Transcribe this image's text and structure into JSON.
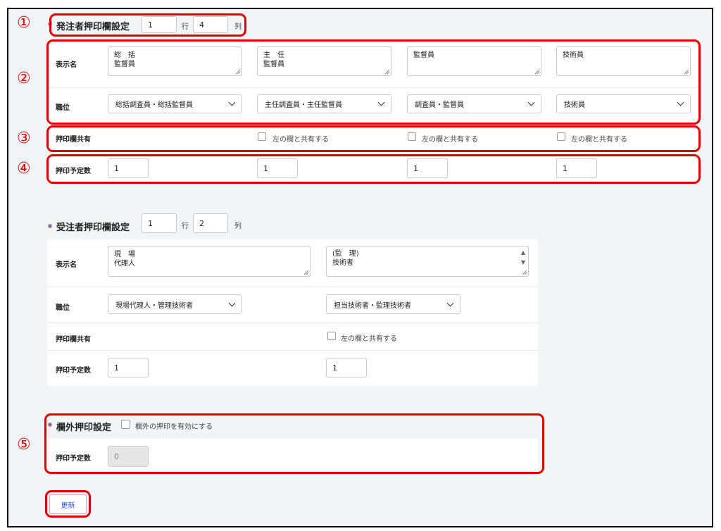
{
  "markers": [
    "①",
    "②",
    "③",
    "④",
    "⑤"
  ],
  "orderer": {
    "title": "発注者押印欄設定",
    "rows_value": "1",
    "rows_unit": "行",
    "cols_value": "4",
    "cols_unit": "列",
    "display_name_label": "表示名",
    "position_label": "職位",
    "share_label": "押印欄共有",
    "planned_label": "押印予定数",
    "columns": [
      {
        "display_name": "総　括\n監督員",
        "position": "総括調査員・総括監督員",
        "share": "",
        "planned": "1"
      },
      {
        "display_name": "主　任\n監督員",
        "position": "主任調査員・主任監督員",
        "share": "左の欄と共有する",
        "planned": "1"
      },
      {
        "display_name": "監督員",
        "position": "調査員・監督員",
        "share": "左の欄と共有する",
        "planned": "1"
      },
      {
        "display_name": "技術員",
        "position": "技術員",
        "share": "左の欄と共有する",
        "planned": "1"
      }
    ]
  },
  "contractor": {
    "title": "受注者押印欄設定",
    "rows_value": "1",
    "rows_unit": "行",
    "cols_value": "2",
    "cols_unit": "列",
    "display_name_label": "表示名",
    "position_label": "職位",
    "share_label": "押印欄共有",
    "planned_label": "押印予定数",
    "columns": [
      {
        "display_name": "現　場\n代理人",
        "position": "現場代理人・管理技術者",
        "share": "",
        "planned": "1"
      },
      {
        "display_name": "(監　理)\n技術者",
        "position": "担当技術者・監理技術者",
        "share": "左の欄と共有する",
        "planned": "1"
      }
    ]
  },
  "outside": {
    "title": "欄外押印設定",
    "enable_label": "欄外の押印を有効にする",
    "planned_label": "押印予定数",
    "planned_value": "0"
  },
  "update_button": "更新"
}
